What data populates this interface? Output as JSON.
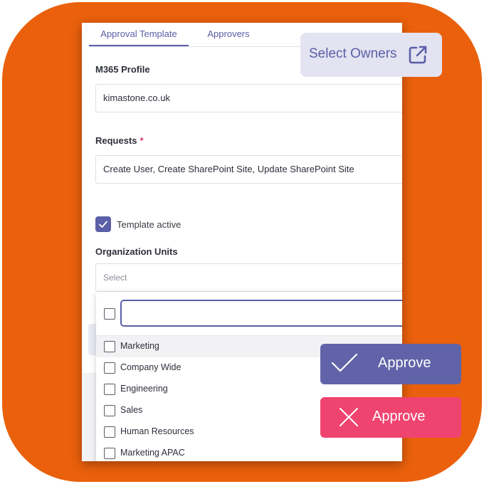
{
  "tabs": [
    {
      "label": "Approval Template",
      "active": true
    },
    {
      "label": "Approvers",
      "active": false
    }
  ],
  "m365_profile": {
    "label": "M365 Profile",
    "value": "kimastone.co.uk"
  },
  "requests": {
    "label": "Requests",
    "required_mark": "*",
    "value": "Create User, Create SharePoint Site, Update SharePoint Site"
  },
  "template_active": {
    "label": "Template active",
    "checked": true
  },
  "org_units": {
    "label": "Organization Units",
    "placeholder": "Select",
    "filter_value": "",
    "options": [
      {
        "label": "Marketing",
        "highlighted": true
      },
      {
        "label": "Company Wide",
        "highlighted": false
      },
      {
        "label": "Engineering",
        "highlighted": false
      },
      {
        "label": "Sales",
        "highlighted": false
      },
      {
        "label": "Human Resources",
        "highlighted": false
      },
      {
        "label": "Marketing APAC",
        "highlighted": false
      }
    ]
  },
  "select_owners": {
    "label": "Select Owners",
    "icon": "external-link-icon"
  },
  "approve_button": {
    "label": "Approve",
    "icon": "check-icon"
  },
  "reject_button": {
    "label": "Approve",
    "icon": "close-icon"
  },
  "colors": {
    "orange": "#ea600c",
    "accent": "#5b5fa7",
    "approve": "#6163a8",
    "reject": "#f04470",
    "pill": "#e3e3f1"
  }
}
